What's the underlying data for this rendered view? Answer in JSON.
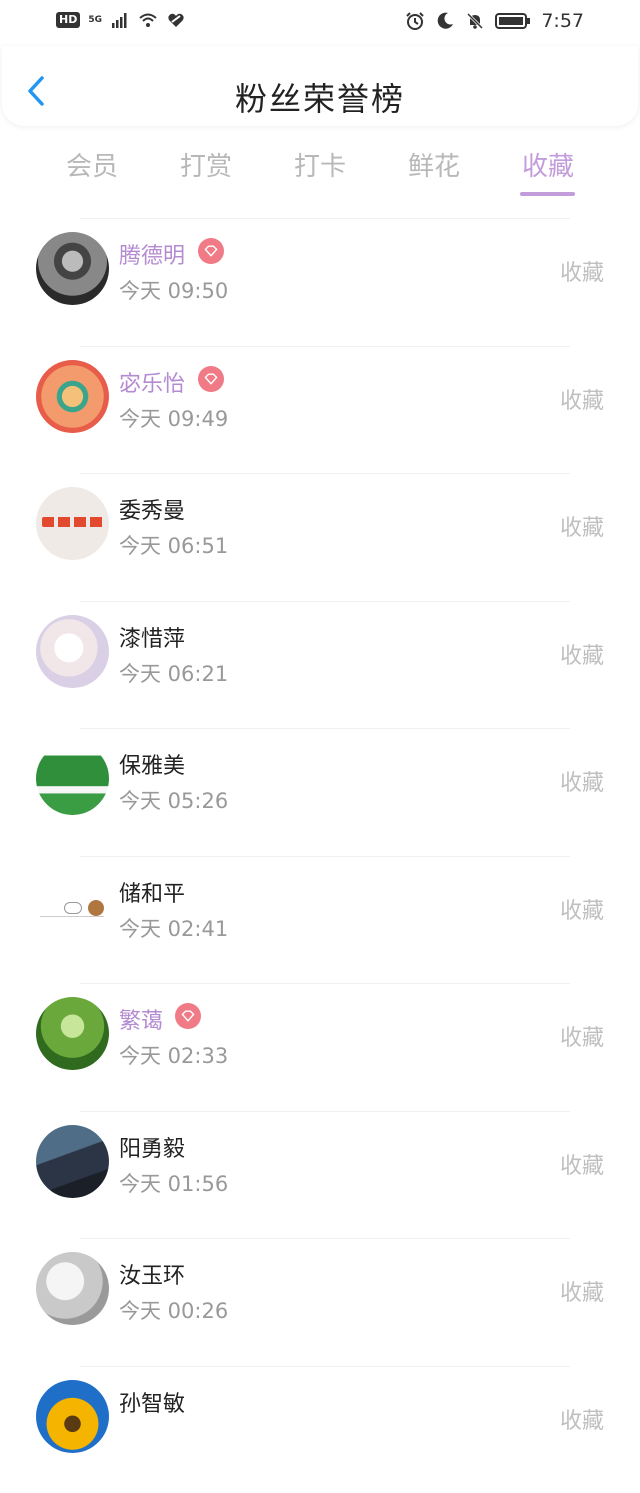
{
  "status_bar": {
    "hd": "HD",
    "network": "5G",
    "time": "7:57"
  },
  "header": {
    "title": "粉丝荣誉榜",
    "back_icon": "chevron-left-icon"
  },
  "tabs": [
    {
      "label": "会员",
      "active": false
    },
    {
      "label": "打赏",
      "active": false
    },
    {
      "label": "打卡",
      "active": false
    },
    {
      "label": "鲜花",
      "active": false
    },
    {
      "label": "收藏",
      "active": true
    }
  ],
  "colors": {
    "accent": "#c39cdc",
    "fan_name": "#b48ad1",
    "badge": "#f07a85",
    "muted": "#999999"
  },
  "fans": [
    {
      "name": "腾德明",
      "time": "今天 09:50",
      "action": "收藏",
      "vip": true
    },
    {
      "name": "宓乐怡",
      "time": "今天 09:49",
      "action": "收藏",
      "vip": true
    },
    {
      "name": "委秀曼",
      "time": "今天 06:51",
      "action": "收藏",
      "vip": false
    },
    {
      "name": "漆惜萍",
      "time": "今天 06:21",
      "action": "收藏",
      "vip": false
    },
    {
      "name": "保雅美",
      "time": "今天 05:26",
      "action": "收藏",
      "vip": false
    },
    {
      "name": "储和平",
      "time": "今天 02:41",
      "action": "收藏",
      "vip": false
    },
    {
      "name": "繁蔼",
      "time": "今天 02:33",
      "action": "收藏",
      "vip": true
    },
    {
      "name": "阳勇毅",
      "time": "今天 01:56",
      "action": "收藏",
      "vip": false
    },
    {
      "name": "汝玉环",
      "time": "今天 00:26",
      "action": "收藏",
      "vip": false
    },
    {
      "name": "孙智敏",
      "time": "",
      "action": "收藏",
      "vip": false
    }
  ]
}
